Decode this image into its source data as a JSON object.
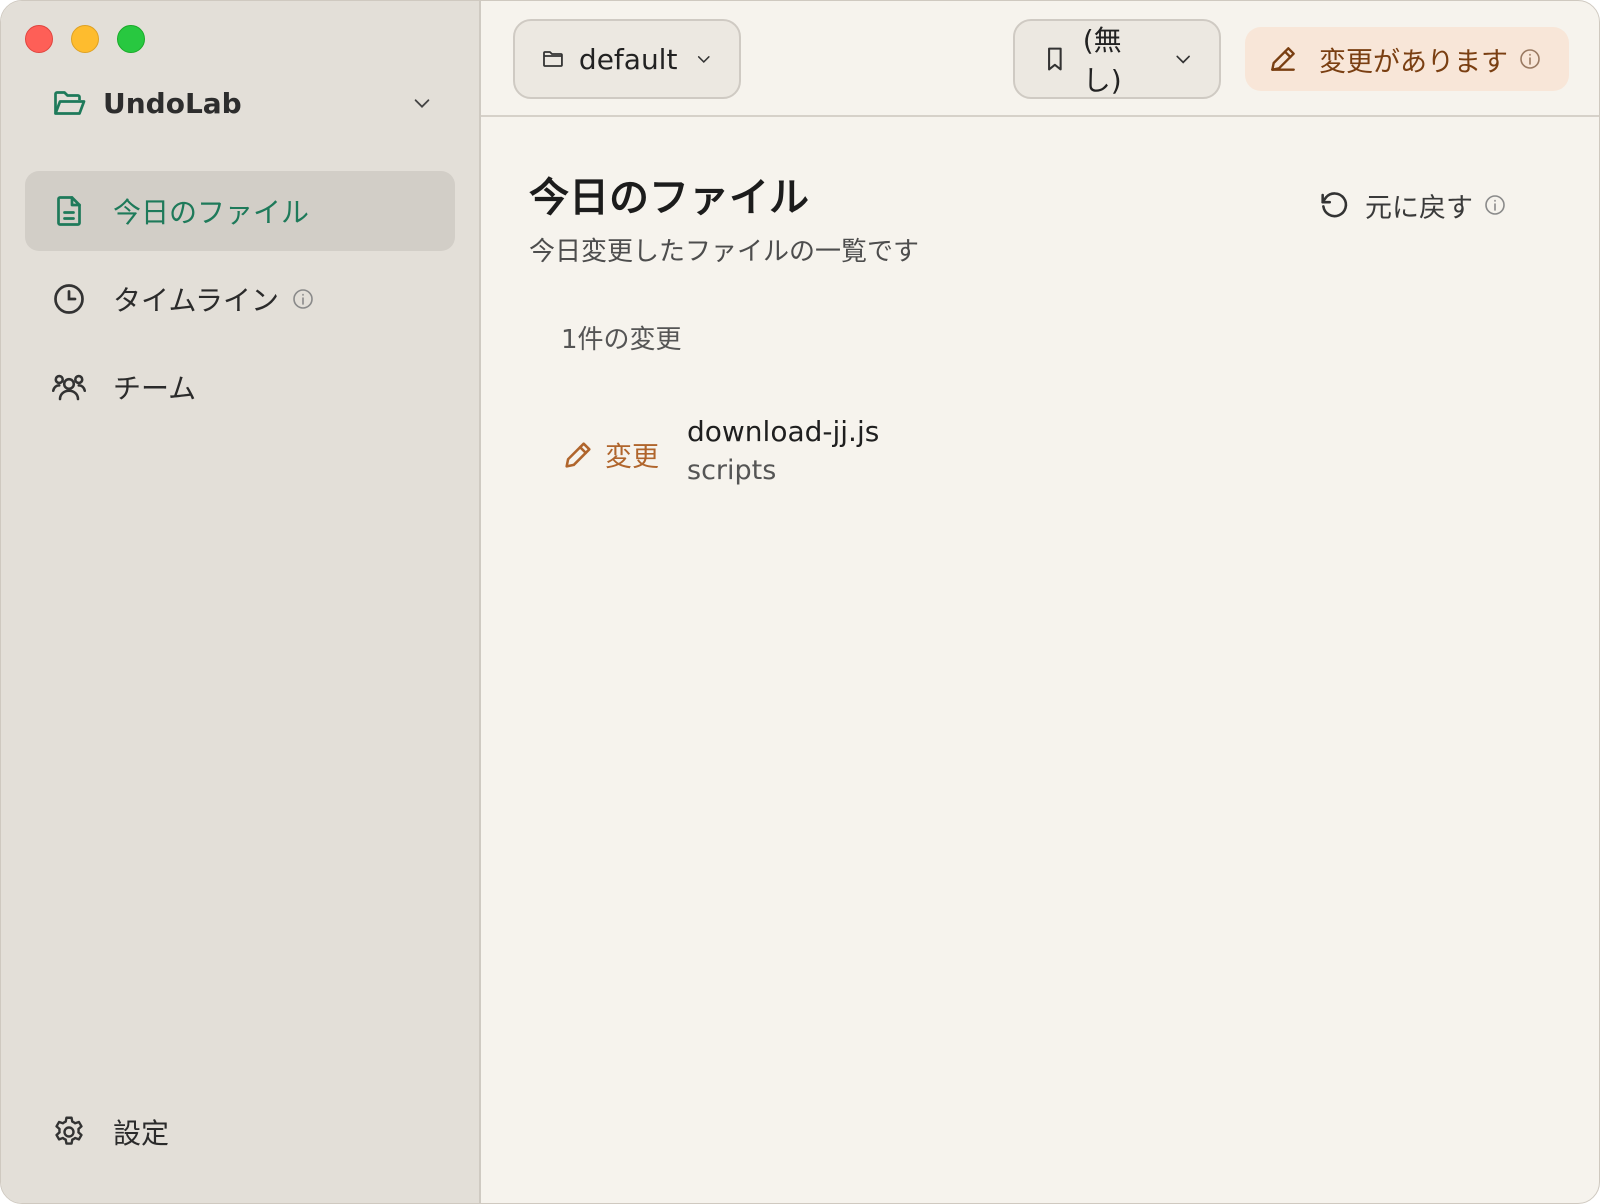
{
  "colors": {
    "accent": "#1e7a5a",
    "sidebar_bg": "#e3dfd8",
    "main_bg": "#f6f3ed",
    "status_bg": "#f8e6d8",
    "status_text": "#7a3f12",
    "change_tag": "#b0652c"
  },
  "window": {
    "controls": [
      "close",
      "minimize",
      "maximize"
    ]
  },
  "sidebar": {
    "project": {
      "name": "UndoLab",
      "icon": "folder-open-icon"
    },
    "items": [
      {
        "label": "今日のファイル",
        "icon": "file-text-icon",
        "active": true
      },
      {
        "label": "タイムライン",
        "icon": "clock-icon",
        "active": false,
        "info": true
      },
      {
        "label": "チーム",
        "icon": "users-icon",
        "active": false
      }
    ],
    "settings": {
      "label": "設定",
      "icon": "gear-icon"
    }
  },
  "toolbar": {
    "branch": {
      "label": "default",
      "icon": "folder-icon"
    },
    "bookmark": {
      "label": "(無し)",
      "icon": "bookmark-icon"
    },
    "status": {
      "label": "変更があります",
      "icon": "pencil-icon"
    }
  },
  "main": {
    "title": "今日のファイル",
    "subtitle": "今日変更したファイルの一覧です",
    "revert_label": "元に戻す",
    "count_label": "1件の変更",
    "changes": [
      {
        "type_label": "変更",
        "file": "download-jj.js",
        "dir": "scripts"
      }
    ]
  }
}
